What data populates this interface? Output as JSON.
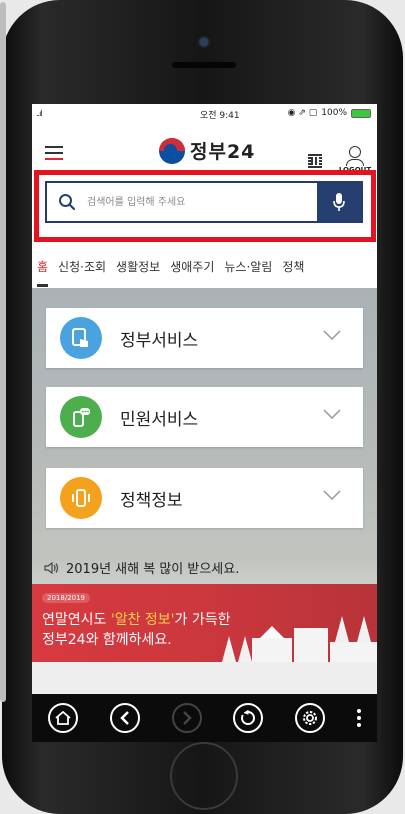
{
  "status": {
    "signal": "..ıl",
    "time": "오전 9:41",
    "icons": "◉ ⇗ ▢",
    "battery": "100%"
  },
  "header": {
    "logo_text": "정부24",
    "logout_label": "LOGOUT"
  },
  "search": {
    "placeholder": "검색어를 입력해 주세요"
  },
  "tabs": [
    "홈",
    "신청·조회",
    "생활정보",
    "생애주기",
    "뉴스·알림",
    "정책"
  ],
  "cards": [
    {
      "label": "정부서비스",
      "icon": "tablet-touch-icon",
      "color": "#4aa3df"
    },
    {
      "label": "민원서비스",
      "icon": "phone-chat-icon",
      "color": "#4cae4c"
    },
    {
      "label": "정책정보",
      "icon": "phone-vibrate-icon",
      "color": "#f4a21d"
    }
  ],
  "notice": {
    "text": "2019년 새해 복 많이 받으세요."
  },
  "banner": {
    "year_badge": "2018/2019",
    "line1_prefix": "연말연시도 ",
    "line1_highlight": "'알찬 정보'",
    "line1_suffix": "가 가득한",
    "line2": "정부24와 함께하세요."
  },
  "toolbar": [
    "home-icon",
    "back-icon",
    "forward-icon",
    "refresh-icon",
    "settings-icon",
    "more-icon"
  ],
  "colors": {
    "accent_red": "#e0262d",
    "navy": "#253f70",
    "highlight_box": "#e3131f"
  }
}
